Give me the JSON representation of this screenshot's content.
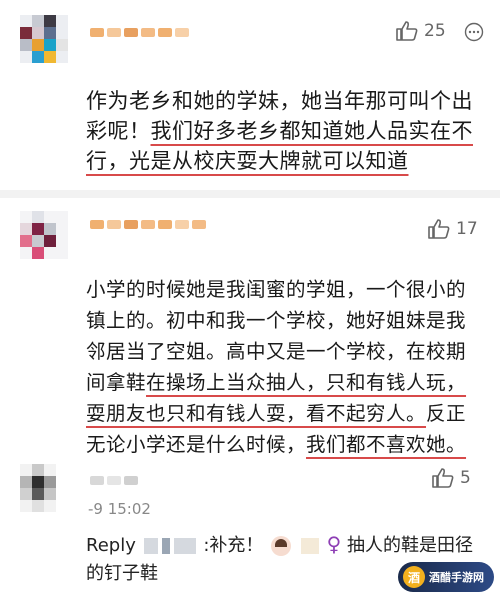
{
  "comments": [
    {
      "like_count": "25",
      "text_plain": "作为老乡和她的学妹，她当年那可叫个出彩呢！",
      "text_underlined": "我们好多老乡都知道她人品实在不行，光是从校庆耍大牌就可以知道"
    },
    {
      "like_count": "17",
      "text_plain": "小学的时候她是我闺蜜的学姐，一个很小的镇上的。初中和我一个学校，她好姐妹是我邻居当了空姐。高中又是一个学校，在校期间拿鞋",
      "text_underlined_1": "在操场上当众抽人，只和有钱人玩，耍朋友也只和有钱人耍，看不起穷人。",
      "text_plain_2": "反正无论小学还是什么时候，",
      "text_underlined_2": "我们都不喜欢她。"
    },
    {
      "like_count": "5",
      "time": "-9 15:02",
      "reply_prefix": "Reply",
      "reply_tail": ":补充！",
      "reply_symbol": "♀",
      "reply_text": "抽人的鞋是田径的钉子鞋"
    }
  ],
  "watermark": {
    "logo_letter": "酒",
    "text": "酒醋手游网"
  },
  "colors": {
    "underline": "#d84a4a",
    "female_symbol": "#8e3fb5"
  }
}
